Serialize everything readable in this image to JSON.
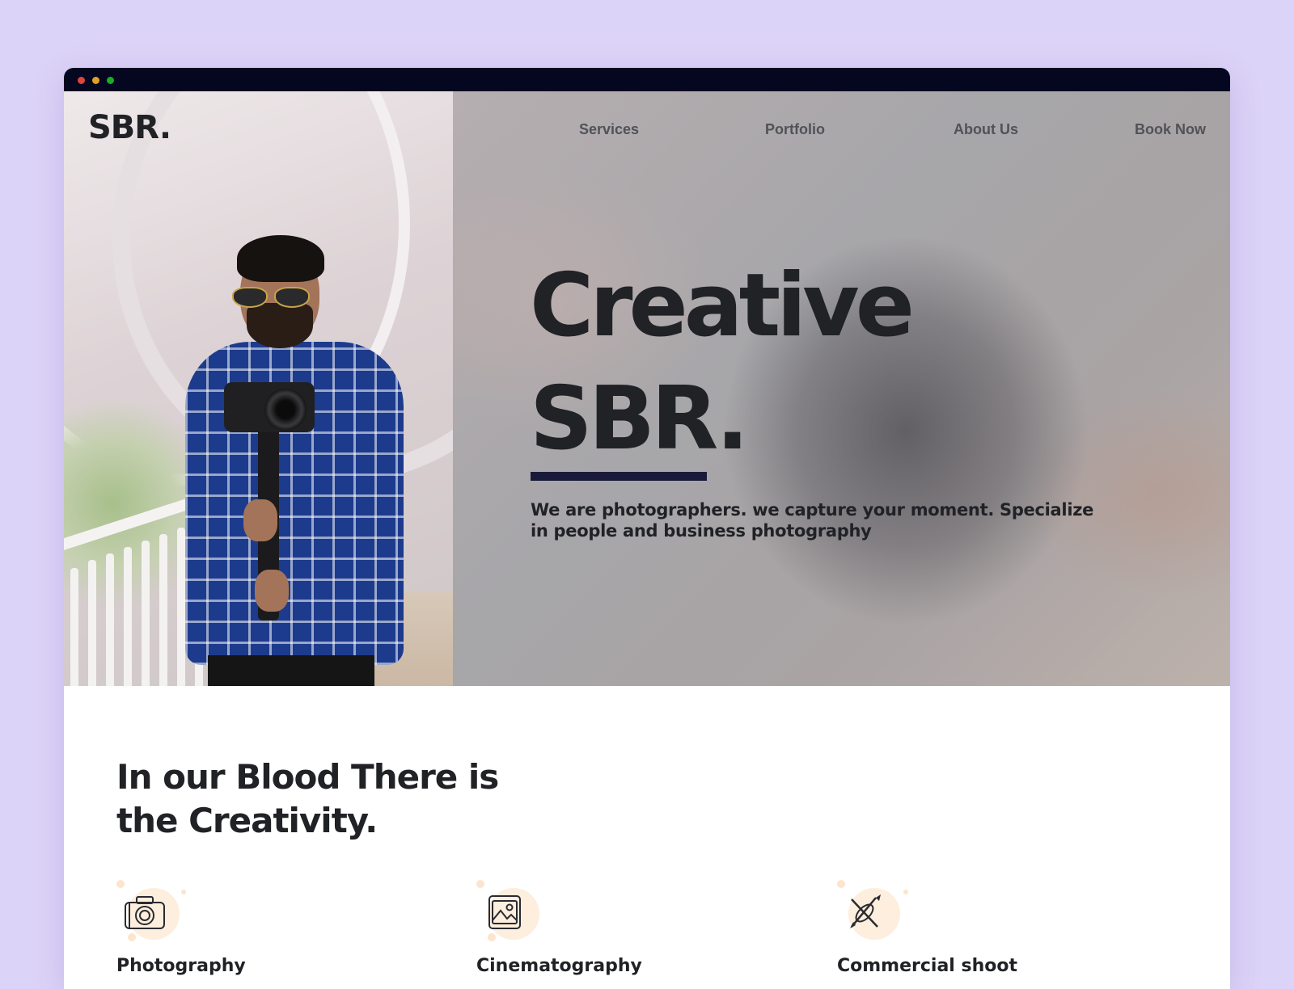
{
  "brand": {
    "logo": "SBR."
  },
  "nav": {
    "items": [
      {
        "label": "Services"
      },
      {
        "label": "Portfolio"
      },
      {
        "label": "About Us"
      },
      {
        "label": "Book Now"
      }
    ]
  },
  "hero": {
    "title_line1": "Creative",
    "title_line2": "SBR.",
    "subtitle": "We are photographers. we capture your moment. Specialize in people and business photography"
  },
  "section": {
    "title": "In our Blood There is the Creativity.",
    "services": [
      {
        "label": "Photography",
        "icon": "camera-icon"
      },
      {
        "label": "Cinematography",
        "icon": "image-frame-icon"
      },
      {
        "label": "Commercial shoot",
        "icon": "design-tools-icon"
      }
    ]
  },
  "colors": {
    "page_background": "#dcd3f8",
    "titlebar": "#05061f",
    "text_dark": "#202226",
    "accent_bar": "#191a3a",
    "icon_bubble": "#fdeedd"
  }
}
